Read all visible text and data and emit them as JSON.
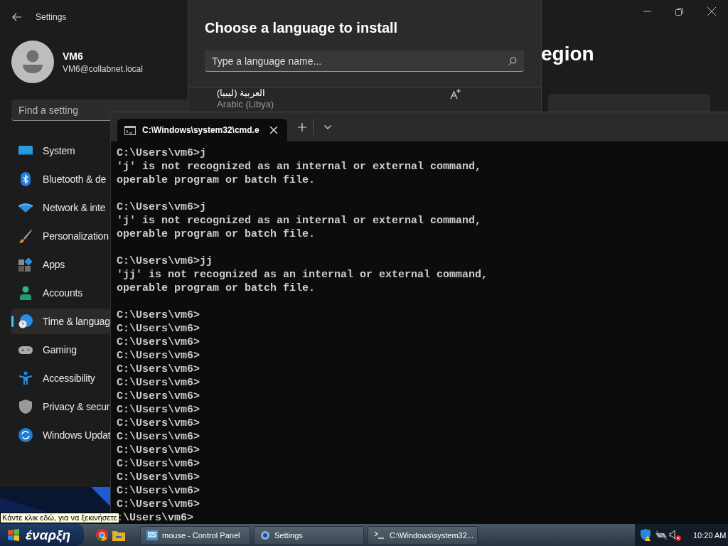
{
  "settings": {
    "title": "Settings",
    "user": {
      "name": "VM6",
      "email": "VM6@collabnet.local"
    },
    "search": {
      "placeholder": "Find a setting"
    },
    "page_title": "egion",
    "nav": [
      {
        "label": "System",
        "selected": false
      },
      {
        "label": "Bluetooth & de",
        "selected": false
      },
      {
        "label": "Network & inte",
        "selected": false
      },
      {
        "label": "Personalization",
        "selected": false
      },
      {
        "label": "Apps",
        "selected": false
      },
      {
        "label": "Accounts",
        "selected": false
      },
      {
        "label": "Time & languag",
        "selected": true
      },
      {
        "label": "Gaming",
        "selected": false
      },
      {
        "label": "Accessibility",
        "selected": false
      },
      {
        "label": "Privacy & secur",
        "selected": false
      },
      {
        "label": "Windows Updat",
        "selected": false
      }
    ]
  },
  "language_dialog": {
    "title": "Choose a language to install",
    "search": {
      "placeholder": "Type a language name..."
    },
    "items": [
      {
        "native": "العربية (ليبيا)",
        "name": "Arabic (Libya)"
      }
    ]
  },
  "terminal": {
    "tab": {
      "title": "C:\\Windows\\system32\\cmd.e",
      "selected": true
    },
    "blocks": [
      [
        "C:\\Users\\vm6>j",
        "'j' is not recognized as an internal or external command,",
        "operable program or batch file."
      ],
      [
        "C:\\Users\\vm6>j",
        "'j' is not recognized as an internal or external command,",
        "operable program or batch file."
      ],
      [
        "C:\\Users\\vm6>jj",
        "'jj' is not recognized as an internal or external command,",
        "operable program or batch file."
      ],
      [
        "C:\\Users\\vm6>",
        "C:\\Users\\vm6>",
        "C:\\Users\\vm6>",
        "C:\\Users\\vm6>",
        "C:\\Users\\vm6>",
        "C:\\Users\\vm6>",
        "C:\\Users\\vm6>",
        "C:\\Users\\vm6>",
        "C:\\Users\\vm6>",
        "C:\\Users\\vm6>",
        "C:\\Users\\vm6>",
        "C:\\Users\\vm6>",
        "C:\\Users\\vm6>",
        "C:\\Users\\vm6>",
        "C:\\Users\\vm6>",
        ":\\Users\\vm6>"
      ]
    ]
  },
  "tooltip": "Κάντε κλικ εδώ, για να ξεκινήσετε",
  "taskbar": {
    "start": "έναρξη",
    "tasks": [
      {
        "label": "mouse - Control Panel"
      },
      {
        "label": "Settings"
      },
      {
        "label": "C:\\Windows\\system32..."
      }
    ],
    "clock": "10:20 AM"
  }
}
